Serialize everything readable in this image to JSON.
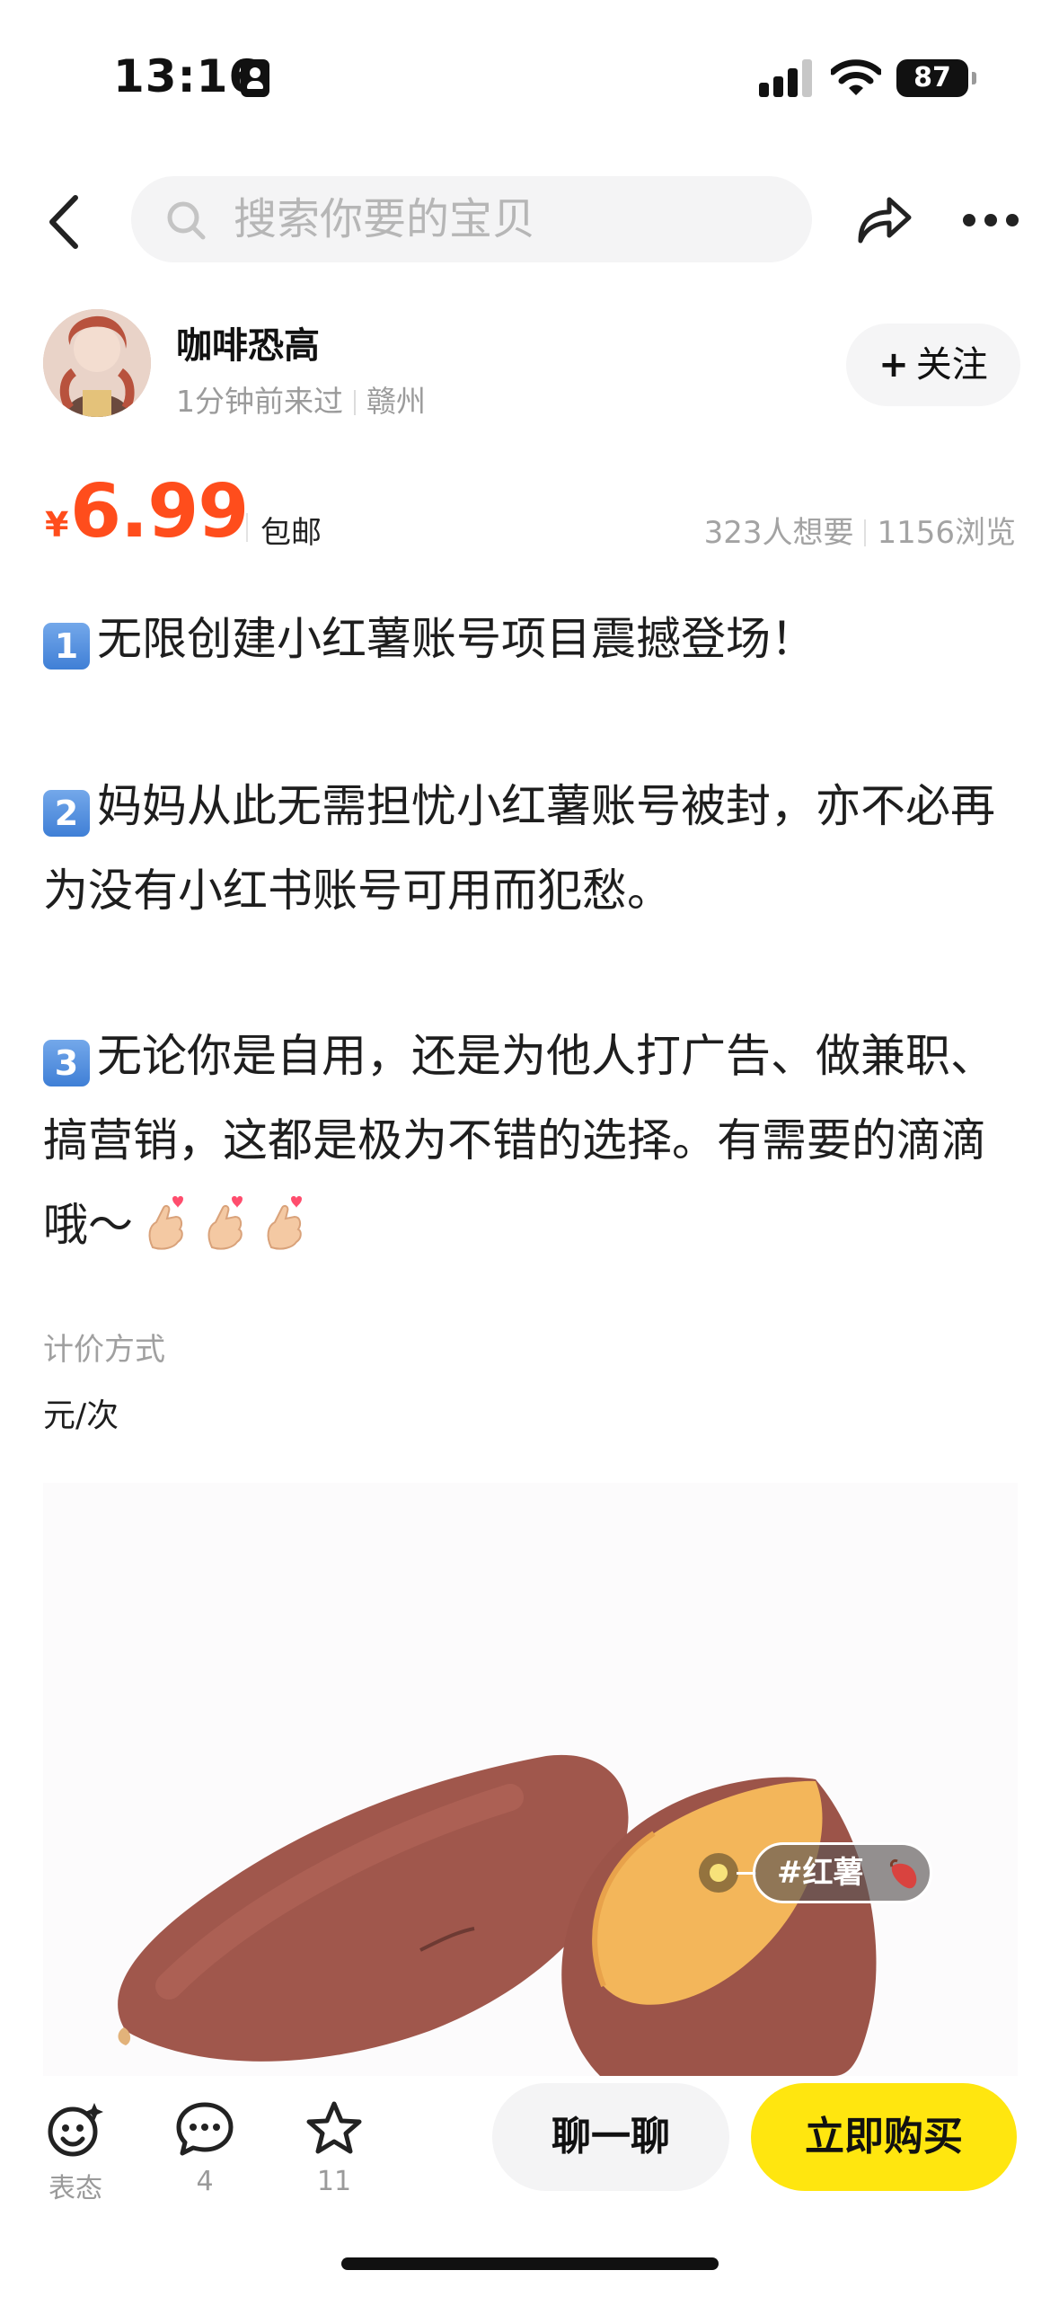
{
  "status_bar": {
    "time": "13:16",
    "battery": "87"
  },
  "nav": {
    "search_placeholder": "搜索你要的宝贝"
  },
  "seller": {
    "name": "咖啡恐高",
    "last_seen": "1分钟前来过",
    "location": "赣州",
    "follow_label": "关注"
  },
  "price": {
    "symbol": "¥",
    "value": "6.99",
    "shipping": "包邮",
    "wants": "323人想要",
    "views": "1156浏览"
  },
  "description": {
    "p1_num": "1",
    "p1_text": "无限创建小红薯账号项目震撼登场！",
    "p2_num": "2",
    "p2_text": "妈妈从此无需担忧小红薯账号被封，亦不必再为没有小红书账号可用而犯愁。",
    "p3_num": "3",
    "p3_text": "无论你是自用，还是为他人打广告、做兼职、搞营销，这都是极为不错的选择。有需要的滴滴哦～"
  },
  "pricing": {
    "label": "计价方式",
    "value": "元/次"
  },
  "image": {
    "tag_label": "#红薯"
  },
  "bottom_bar": {
    "react_label": "表态",
    "comment_count": "4",
    "favorite_count": "11",
    "chat_label": "聊一聊",
    "buy_label": "立即购买"
  },
  "colors": {
    "price": "#ff4d1c",
    "buy_button": "#ffe60f",
    "chat_button": "#f4f4f5"
  },
  "icons": [
    "back-icon",
    "search-icon",
    "share-icon",
    "more-icon",
    "react-icon",
    "comment-icon",
    "star-icon",
    "finger-heart-icon",
    "sweet-potato-icon"
  ]
}
